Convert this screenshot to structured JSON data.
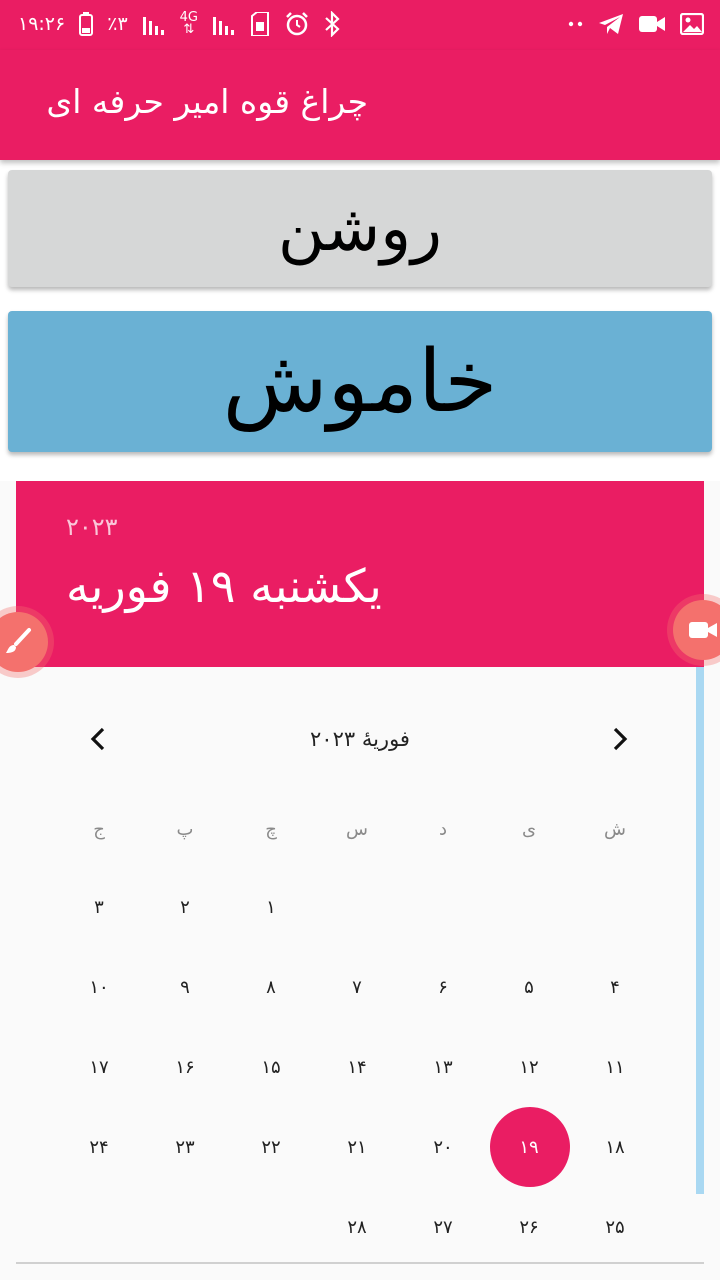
{
  "status_bar": {
    "time": "۱۹:۲۶",
    "battery": "٪۳",
    "network": "4G",
    "icons": [
      "battery-icon",
      "signal-icon",
      "network-4g-icon",
      "signal-icon",
      "sim-icon",
      "alarm-icon",
      "bluetooth-icon",
      "more-dots-icon",
      "telegram-icon",
      "video-icon",
      "gallery-icon"
    ]
  },
  "app_bar": {
    "title": "چراغ قوه امیر حرفه ای"
  },
  "buttons": {
    "on_label": "روشن",
    "off_label": "خاموش"
  },
  "calendar": {
    "year": "۲۰۲۳",
    "selected_date": "یکشنبه ۱۹ فوریه",
    "month_label": "فوریهٔ ۲۰۲۳",
    "weekdays": [
      "ش",
      "ی",
      "د",
      "س",
      "چ",
      "پ",
      "ج"
    ],
    "weeks": [
      [
        "",
        "",
        "",
        "",
        "۱",
        "۲",
        "۳"
      ],
      [
        "۴",
        "۵",
        "۶",
        "۷",
        "۸",
        "۹",
        "۱۰"
      ],
      [
        "۱۱",
        "۱۲",
        "۱۳",
        "۱۴",
        "۱۵",
        "۱۶",
        "۱۷"
      ],
      [
        "۱۸",
        "۱۹",
        "۲۰",
        "۲۱",
        "۲۲",
        "۲۳",
        "۲۴"
      ],
      [
        "۲۵",
        "۲۶",
        "۲۷",
        "۲۸",
        "",
        "",
        ""
      ]
    ],
    "selected_day": "۱۹"
  },
  "colors": {
    "primary": "#ea1d63",
    "on_button": "#d6d7d7",
    "off_button": "#6ab1d4",
    "scrollbar": "#a9d8f2",
    "floating": "#f4716d"
  }
}
